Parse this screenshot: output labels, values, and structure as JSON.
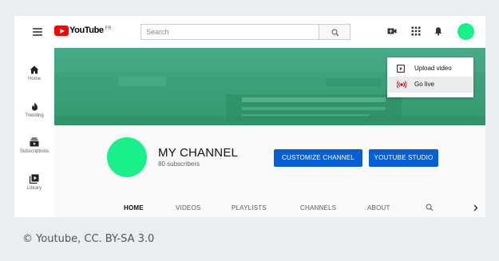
{
  "header": {
    "logo_text": "YouTube",
    "logo_country": "FR",
    "search_placeholder": "Search"
  },
  "sidebar": {
    "items": [
      {
        "label": "Home",
        "icon": "home-icon"
      },
      {
        "label": "Trending",
        "icon": "flame-icon"
      },
      {
        "label": "Subscriptions",
        "icon": "subscriptions-icon"
      },
      {
        "label": "Library",
        "icon": "library-icon"
      }
    ]
  },
  "create_menu": {
    "items": [
      {
        "label": "Upload video",
        "icon": "upload-video-icon"
      },
      {
        "label": "Go live",
        "icon": "go-live-icon"
      }
    ]
  },
  "channel": {
    "title": "MY CHANNEL",
    "subscribers": "80 subscribers",
    "customize_label": "CUSTOMIZE CHANNEL",
    "studio_label": "YOUTUBE STUDIO",
    "tabs": [
      "HOME",
      "VIDEOS",
      "PLAYLISTS",
      "CHANNELS",
      "ABOUT"
    ]
  },
  "colors": {
    "accent": "#065fd4",
    "avatar": "#19ef8a",
    "banner": "#3a9f79",
    "logo_red": "#ff0000"
  },
  "credit": "© Youtube, CC. BY-SA 3.0"
}
